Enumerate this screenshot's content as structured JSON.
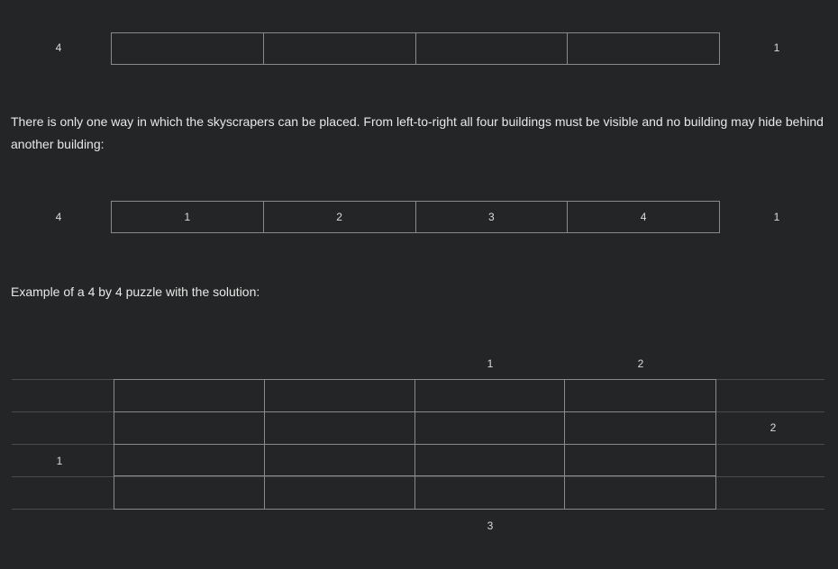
{
  "example1": {
    "left_clue": "4",
    "right_clue": "1",
    "cells": [
      "",
      "",
      "",
      ""
    ]
  },
  "paragraph1": "There is only one way in which the skyscrapers can be placed. From left-to-right all four buildings must be visible and no building may hide behind another building:",
  "example2": {
    "left_clue": "4",
    "right_clue": "1",
    "cells": [
      "1",
      "2",
      "3",
      "4"
    ]
  },
  "paragraph2": "Example of a 4 by 4 puzzle with the solution:",
  "puzzle": {
    "top_clues": [
      "",
      "",
      "1",
      "2"
    ],
    "bottom_clues": [
      "",
      "",
      "3",
      ""
    ],
    "left_clues": [
      "",
      "",
      "1",
      ""
    ],
    "right_clues": [
      "",
      "2",
      "",
      ""
    ]
  }
}
